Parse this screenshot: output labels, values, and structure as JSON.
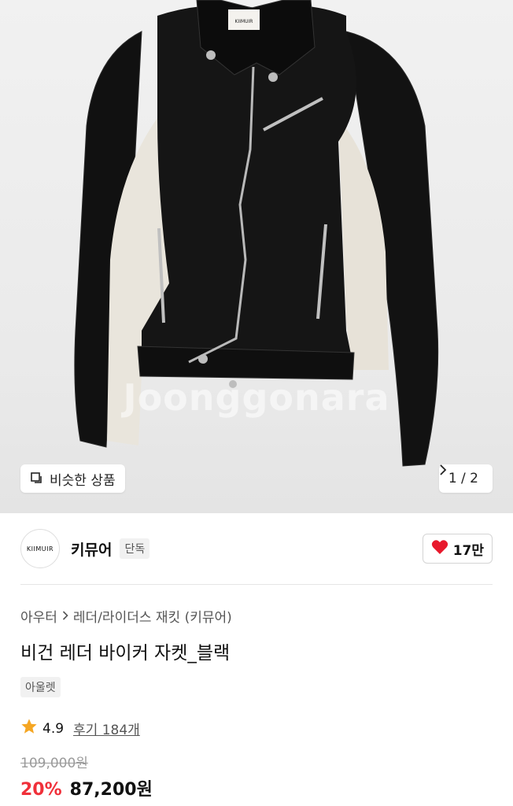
{
  "hero": {
    "watermark": "Joonggonara",
    "similar_label": "비슷한 상품",
    "page_indicator": "1 / 2",
    "jacket_tag": "KIIMUIR"
  },
  "store": {
    "logo_text": "KIIMUIR",
    "name": "키뮤어",
    "badge": "단독",
    "likes": "17만"
  },
  "product": {
    "breadcrumb": [
      "아우터",
      "레더/라이더스 재킷 (키뮤어)"
    ],
    "title": "비건 레더 바이커 자켓_블랙",
    "tag": "아울렛",
    "rating": "4.9",
    "review_label": "후기 184개",
    "original_price": "109,000원",
    "discount": "20%",
    "price": "87,200원"
  },
  "colors": {
    "accent_red": "#f0303a",
    "star": "#f5a623",
    "heart": "#e8192c"
  },
  "icons": [
    "similar-products-icon",
    "chevron-right-icon",
    "heart-icon",
    "star-icon"
  ]
}
